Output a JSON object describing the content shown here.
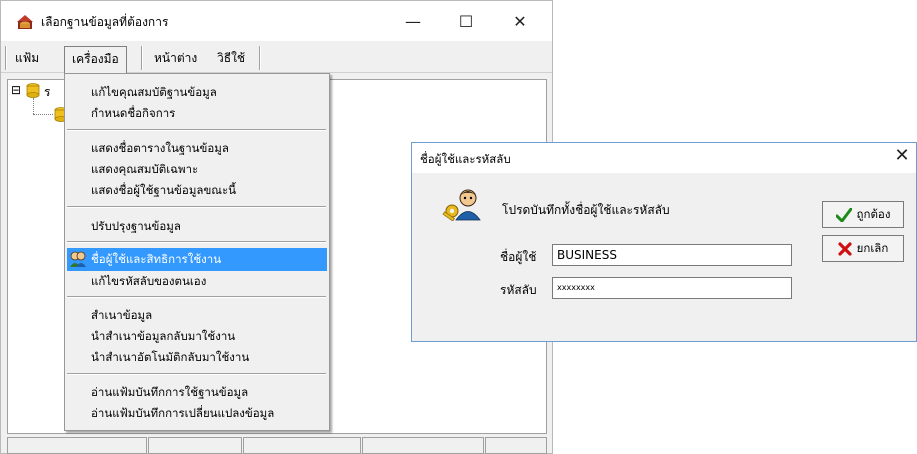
{
  "main_window": {
    "title": "เลือกฐานข้อมูลที่ต้องการ",
    "controls": {
      "minimize": "—",
      "maximize": "☐",
      "close": "✕"
    }
  },
  "menubar": {
    "items": [
      {
        "label": "แฟ้ม"
      },
      {
        "label": "เครื่องมือ"
      },
      {
        "label": "หน้าต่าง"
      },
      {
        "label": "วิธีใช้"
      }
    ]
  },
  "tree": {
    "root_expander": "⊟",
    "root_label_partial": "ร"
  },
  "dropdown": {
    "groups": [
      [
        "แก้ไขคุณสมบัติฐานข้อมูล",
        "กำหนดชื่อกิจการ"
      ],
      [
        "แสดงชื่อตารางในฐานข้อมูล",
        "แสดงคุณสมบัติเฉพาะ",
        "แสดงชื่อผู้ใช้ฐานข้อมูลขณะนี้"
      ],
      [
        "ปรับปรุงฐานข้อมูล"
      ],
      [
        "ชื่อผู้ใช้และสิทธิการใช้งาน",
        "แก้ไขรหัสลับของตนเอง"
      ],
      [
        "สำเนาข้อมูล",
        "นำสำเนาข้อมูลกลับมาใช้งาน",
        "นำสำเนาอัตโนมัติกลับมาใช้งาน"
      ],
      [
        "อ่านแฟ้มบันทึกการใช้ฐานข้อมูล",
        "อ่านแฟ้มบันทึกการเปลี่ยนแปลงข้อมูล"
      ]
    ],
    "highlighted": "ชื่อผู้ใช้และสิทธิการใช้งาน",
    "highlight_color": "#3399ff"
  },
  "dialog": {
    "title": "ชื่อผู้ใช้และรหัสลับ",
    "close": "✕",
    "prompt": "โปรดบันทึกทั้งชื่อผู้ใช้และรหัสลับ",
    "username_label": "ชื่อผู้ใช้",
    "username_value": "BUSINESS",
    "password_label": "รหัสลับ",
    "password_value": "xxxxxxxx",
    "ok_label": "ถูกต้อง",
    "cancel_label": "ยกเลิก",
    "ok_icon": "checkmark-icon",
    "cancel_icon": "x-icon",
    "ok_icon_color": "#1a8a1a",
    "cancel_icon_color": "#d01010"
  }
}
